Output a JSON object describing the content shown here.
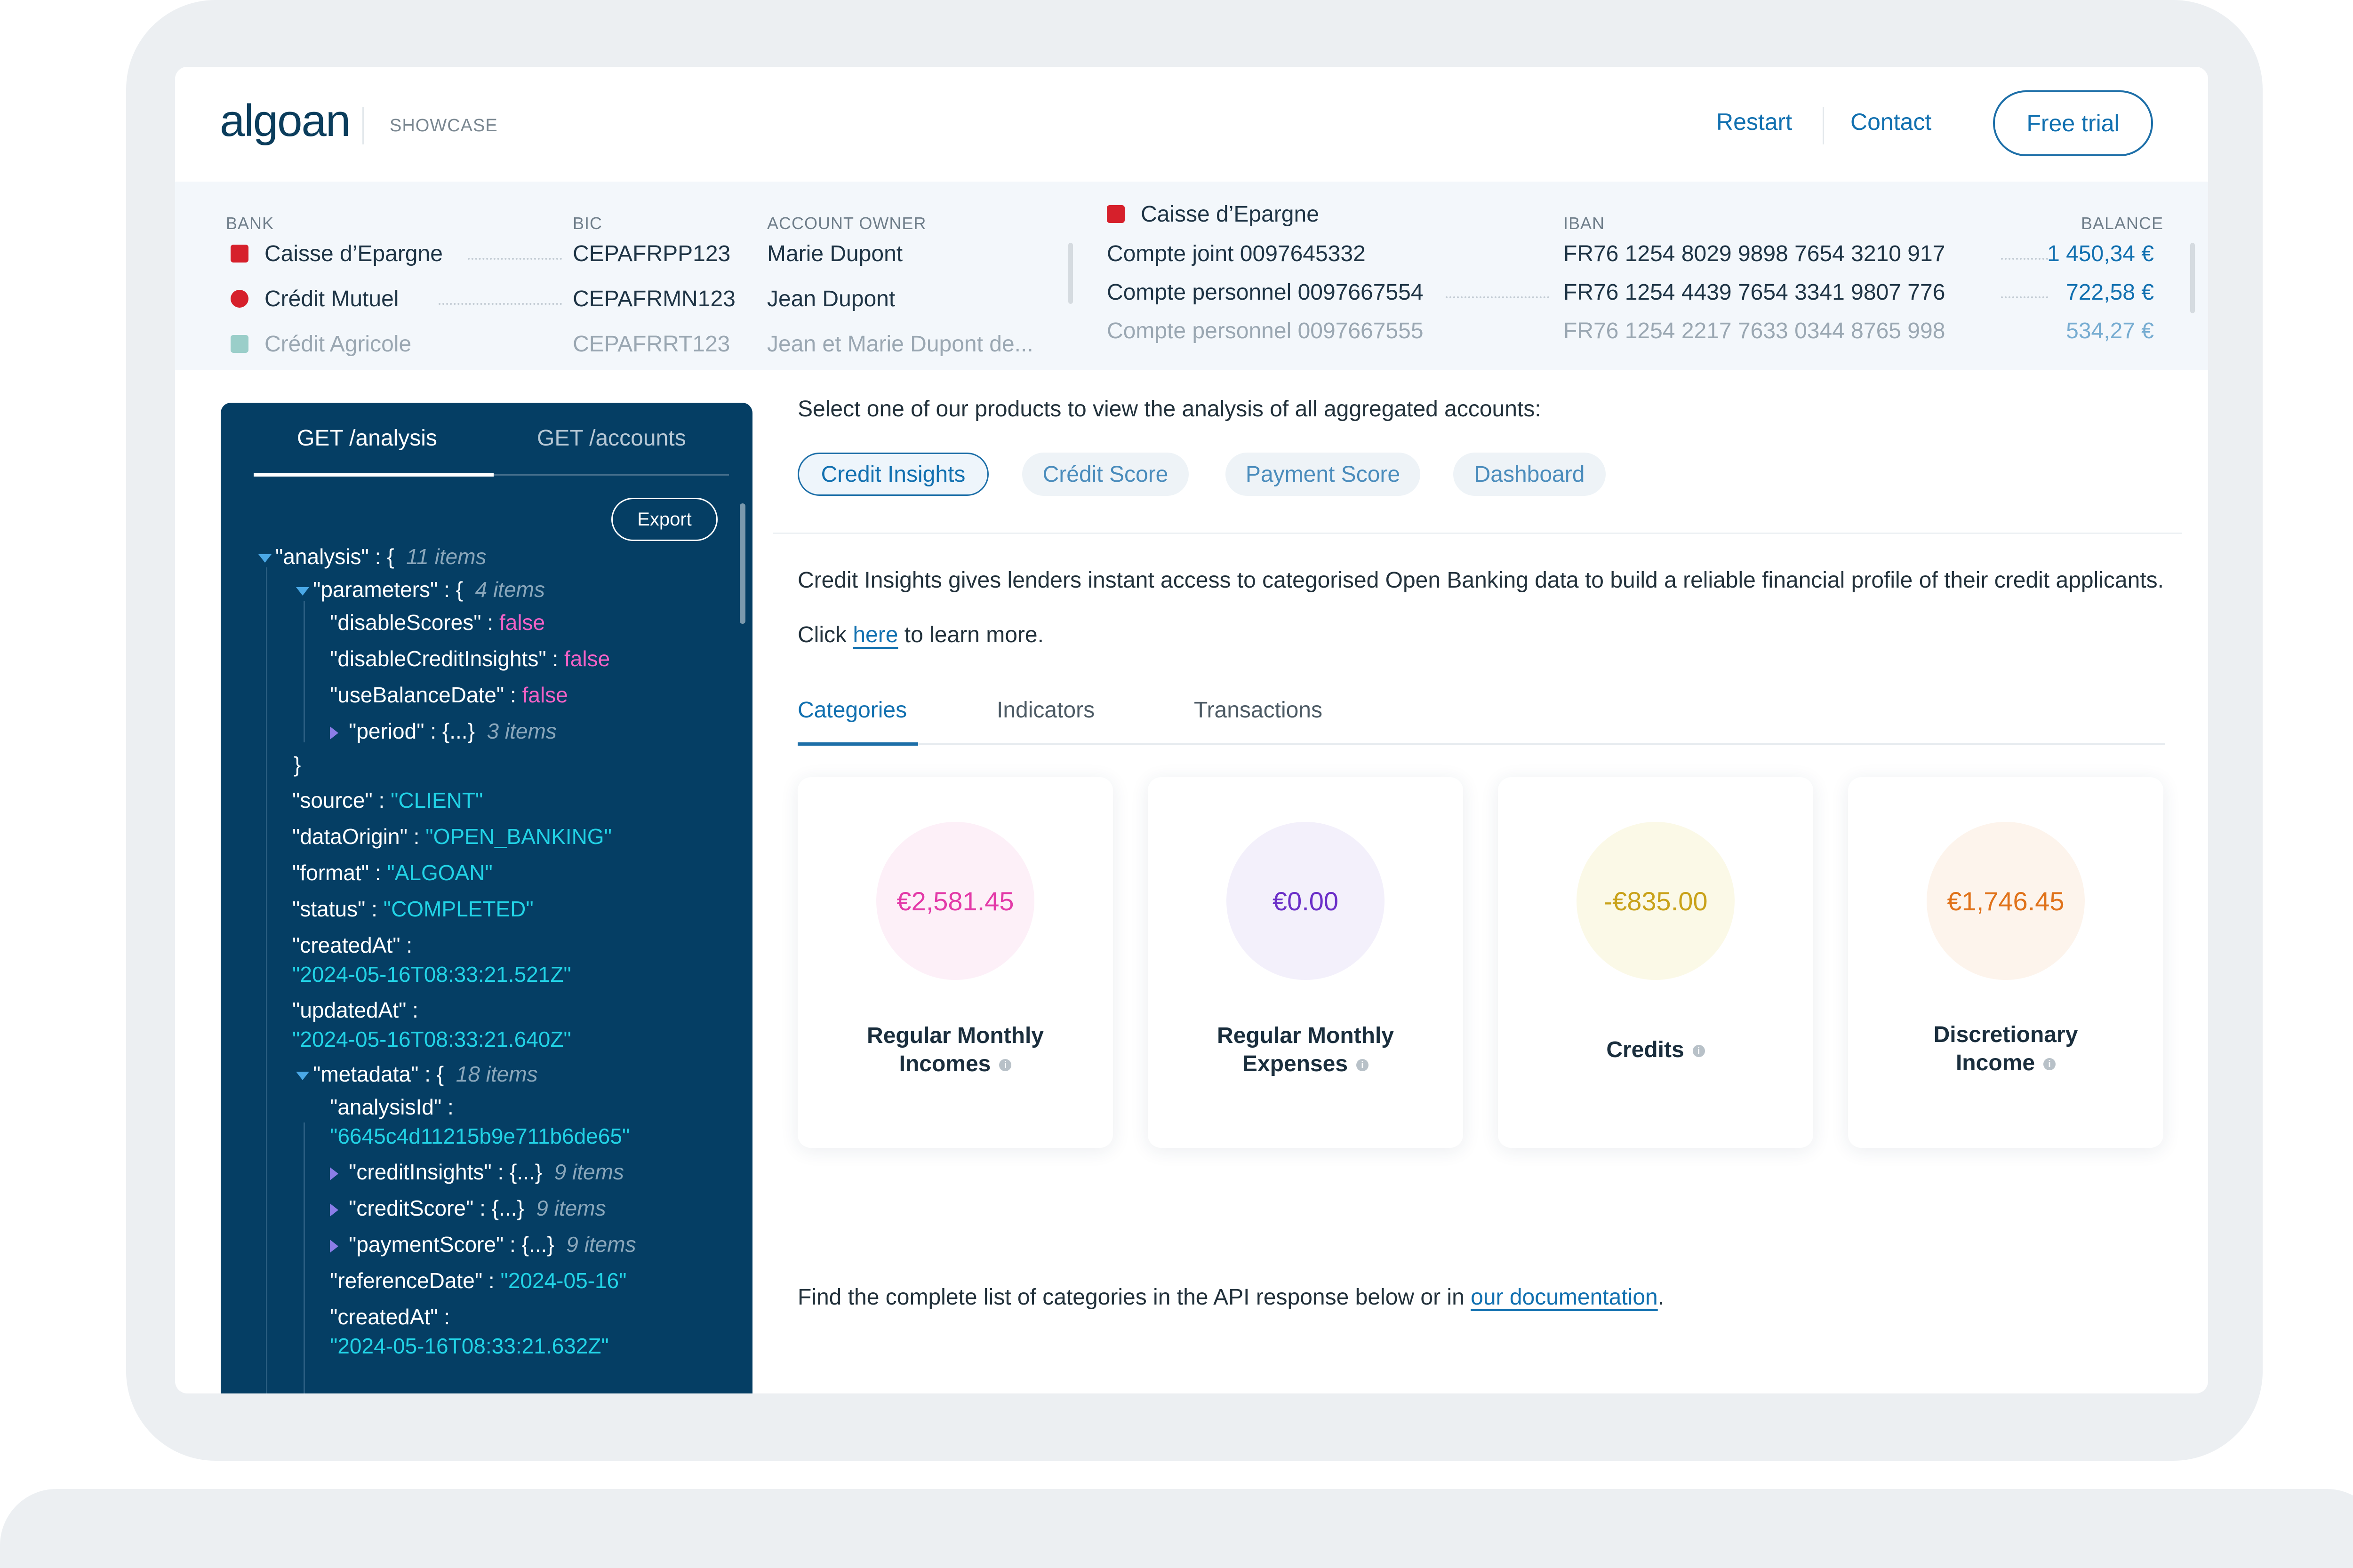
{
  "header": {
    "logo": "algoan",
    "section": "SHOWCASE",
    "nav": {
      "restart": "Restart",
      "contact": "Contact",
      "free_trial": "Free trial"
    }
  },
  "accounts_strip": {
    "columns": {
      "bank": "BANK",
      "bic": "BIC",
      "owner": "ACCOUNT OWNER",
      "iban": "IBAN",
      "balance": "BALANCE"
    },
    "banks": [
      {
        "name": "Caisse d’Epargne",
        "bic": "CEPAFRPP123",
        "owner": "Marie Dupont"
      },
      {
        "name": "Crédit Mutuel",
        "bic": "CEPAFRMN123",
        "owner": "Jean Dupont"
      },
      {
        "name": "Crédit Agricole",
        "bic": "CEPAFRRT123",
        "owner": "Jean et Marie Dupont de..."
      }
    ],
    "selected_bank": "Caisse d’Epargne",
    "accounts": [
      {
        "name": "Compte joint 0097645332",
        "iban": "FR76 1254 8029 9898 7654 3210 917",
        "balance": "1 450,34 €"
      },
      {
        "name": "Compte personnel 0097667554",
        "iban": "FR76 1254 4439 7654 3341 9807 776",
        "balance": "722,58 €"
      },
      {
        "name": "Compte personnel 0097667555",
        "iban": "FR76 1254 2217 7633 0344 8765 998",
        "balance": "534,27 €"
      }
    ],
    "colors": {
      "caisse": "#d6202b",
      "mutuel": "#d6202b",
      "agricole": "#2e9c8c"
    }
  },
  "json_panel": {
    "tabs": [
      "GET /analysis",
      "GET /accounts"
    ],
    "export_label": "Export",
    "lines": {
      "l01": {
        "key": "\"analysis\"",
        "brace": "{",
        "count": "11 items"
      },
      "l02": {
        "key": "\"parameters\"",
        "brace": "{",
        "count": "4 items"
      },
      "l03": {
        "key": "\"disableScores\"",
        "value": "false"
      },
      "l04": {
        "key": "\"disableCreditInsights\"",
        "value": "false"
      },
      "l05": {
        "key": "\"useBalanceDate\"",
        "value": "false"
      },
      "l06": {
        "key": "\"period\"",
        "brace": "{...}",
        "count": "3 items"
      },
      "l07": {
        "close": "}"
      },
      "l08": {
        "key": "\"source\"",
        "value": "\"CLIENT\""
      },
      "l09": {
        "key": "\"dataOrigin\"",
        "value": "\"OPEN_BANKING\""
      },
      "l10": {
        "key": "\"format\"",
        "value": "\"ALGOAN\""
      },
      "l11": {
        "key": "\"status\"",
        "value": "\"COMPLETED\""
      },
      "l12": {
        "key": "\"createdAt\"",
        "value": "\"2024-05-16T08:33:21.521Z\""
      },
      "l13": {
        "key": "\"updatedAt\"",
        "value": "\"2024-05-16T08:33:21.640Z\""
      },
      "l14": {
        "key": "\"metadata\"",
        "brace": "{",
        "count": "18 items"
      },
      "l15": {
        "key": "\"analysisId\"",
        "value": "\"6645c4d11215b9e711b6de65\""
      },
      "l16": {
        "key": "\"creditInsights\"",
        "brace": "{...}",
        "count": "9 items"
      },
      "l17": {
        "key": "\"creditScore\"",
        "brace": "{...}",
        "count": "9 items"
      },
      "l18": {
        "key": "\"paymentScore\"",
        "brace": "{...}",
        "count": "9 items"
      },
      "l19": {
        "key": "\"referenceDate\"",
        "value": "\"2024-05-16\""
      },
      "l20": {
        "key": "\"createdAt\"",
        "value": "\"2024-05-16T08:33:21.632Z\""
      }
    },
    "colors": {
      "background": "#053e64",
      "string": "#22d3e6",
      "boolean": "#f262c6",
      "count": "#8aa7bb"
    }
  },
  "main": {
    "intro": "Select one of our products to view the analysis of all aggregated accounts:",
    "products": [
      "Credit Insights",
      "Crédit Score",
      "Payment Score",
      "Dashboard"
    ],
    "description": "Credit Insights gives lenders instant access to categorised Open Banking data to build a reliable financial profile of their credit applicants.",
    "learn_more": {
      "prefix": "Click",
      "link": "here",
      "suffix": "to learn more."
    },
    "sub_tabs": [
      "Categories",
      "Indicators",
      "Transactions"
    ],
    "cards": [
      {
        "value": "€2,581.45",
        "label1": "Regular Monthly",
        "label2": "Incomes",
        "color": "#e33aa8",
        "bg": "#fdf0f8"
      },
      {
        "value": "€0.00",
        "label1": "Regular Monthly",
        "label2": "Expenses",
        "color": "#6b2fc8",
        "bg": "#f3f0fb"
      },
      {
        "value": "-€835.00",
        "label1": "Credits",
        "label2": "",
        "color": "#c9a21a",
        "bg": "#fbf9e7"
      },
      {
        "value": "€1,746.45",
        "label1": "Discretionary",
        "label2": "Income",
        "color": "#e0721a",
        "bg": "#fdf4ec"
      }
    ],
    "footer": {
      "text": "Find the complete list of categories in the API response below or in",
      "link": "our documentation",
      "end": "."
    }
  }
}
